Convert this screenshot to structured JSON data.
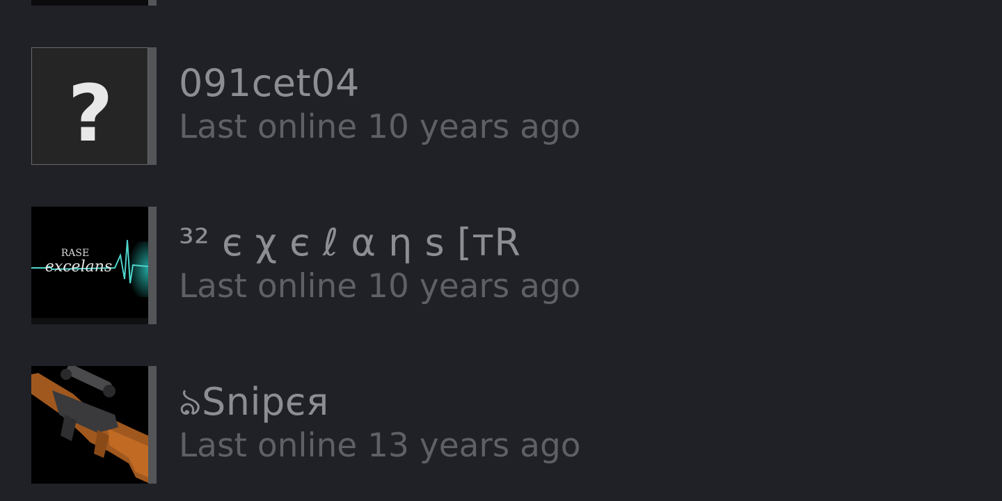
{
  "friends": [
    {
      "name": "",
      "status": "",
      "avatar_icon": "dark-avatar-icon"
    },
    {
      "name": "091cet04",
      "status": "Last online 10 years ago",
      "avatar_icon": "question-mark-icon"
    },
    {
      "name": "³² є χ є ℓ α η ѕ [тR",
      "status": "Last online 10 years ago",
      "avatar_icon": "excelans-heartbeat-avatar",
      "avatar_text_top": "RASE",
      "avatar_text_main": "excelans"
    },
    {
      "name": "ঌSnipєя",
      "status": "Last online 13 years ago",
      "avatar_icon": "sniper-rifle-avatar"
    }
  ],
  "colors": {
    "background": "#202127",
    "offline_bar": "#545558",
    "name_text": "#8d8e92",
    "status_text": "#5f6066"
  }
}
